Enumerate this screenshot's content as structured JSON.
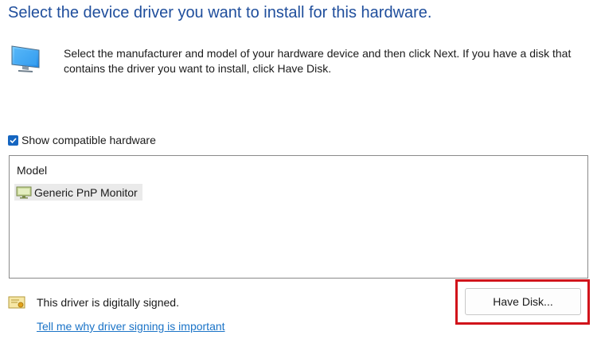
{
  "header": {
    "title": "Select the device driver you want to install for this hardware."
  },
  "intro": {
    "icon": "monitor-icon",
    "text": "Select the manufacturer and model of your hardware device and then click Next. If you have a disk that contains the driver you want to install, click Have Disk."
  },
  "compatible": {
    "label": "Show compatible hardware",
    "checked": true
  },
  "model_list": {
    "header": "Model",
    "items": [
      {
        "label": "Generic PnP Monitor",
        "icon": "monitor-device-icon",
        "selected": true
      }
    ]
  },
  "signing": {
    "icon": "certificate-icon",
    "status_text": "This driver is digitally signed.",
    "link_text": "Tell me why driver signing is important"
  },
  "buttons": {
    "have_disk_label": "Have Disk..."
  },
  "colors": {
    "title": "#1f4e9c",
    "link": "#1a73c7",
    "checkbox": "#1565c0",
    "highlight": "#d1141b",
    "selected_item_bg": "#eaeaea"
  }
}
